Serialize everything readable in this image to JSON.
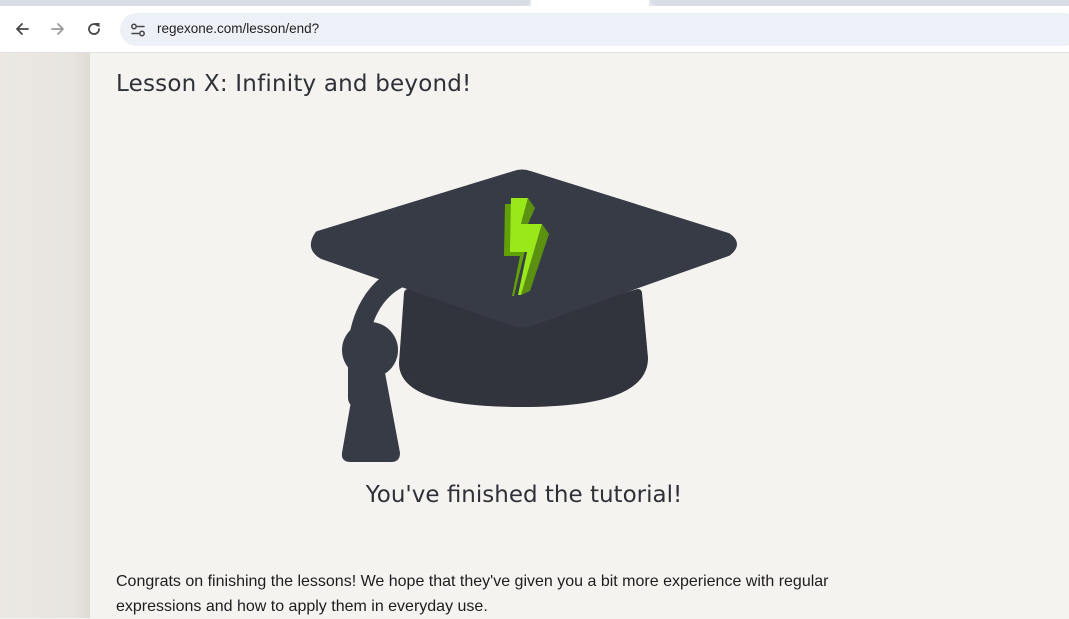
{
  "browser": {
    "url": "regexone.com/lesson/end?",
    "back_icon": "arrow-left-icon",
    "forward_icon": "arrow-right-icon",
    "reload_icon": "reload-icon",
    "site_info_icon": "tune-icon"
  },
  "page": {
    "lesson_title": "Lesson X: Infinity and beyond!",
    "illustration_icon": "graduation-cap-lightning-icon",
    "finished_heading": "You've finished the tutorial!",
    "congrats_text": "Congrats on finishing the lessons! We hope that they've given you a bit more experience with regular expressions and how to apply them in everyday use."
  },
  "colors": {
    "cap": "#373b45",
    "lightning": "#99e81a",
    "lightning_shade": "#62a007",
    "page_background": "#f5f3f0"
  }
}
